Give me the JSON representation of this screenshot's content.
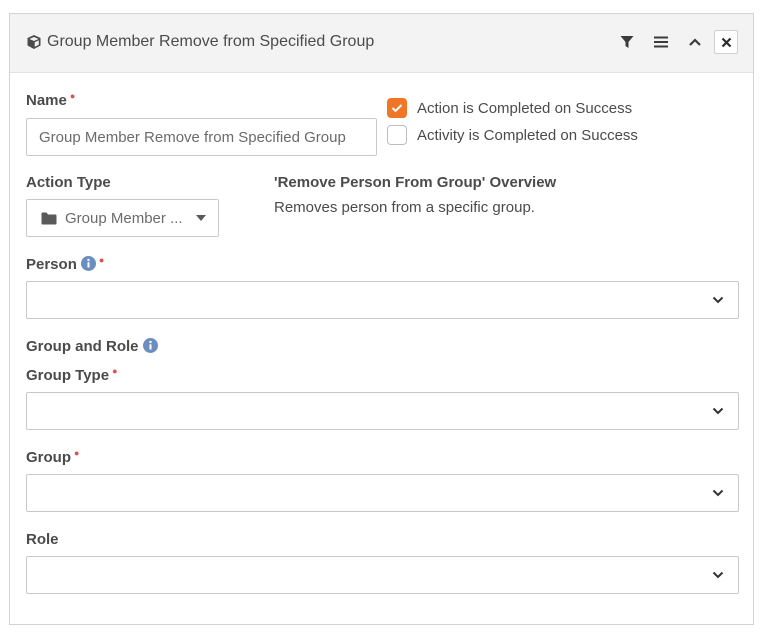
{
  "panel": {
    "title": "Group Member Remove from Specified Group",
    "icons": [
      "cube-icon",
      "filter-icon",
      "hamburger-menu-icon",
      "chevron-up-icon",
      "close-icon"
    ]
  },
  "fields": {
    "name": {
      "label": "Name",
      "value": "Group Member Remove from Specified Group",
      "required": true
    },
    "action_complete": {
      "label": "Action is Completed on Success",
      "checked": true
    },
    "activity_complete": {
      "label": "Activity is Completed on Success",
      "checked": false
    },
    "action_type": {
      "label": "Action Type",
      "value": "Group Member ...",
      "icon": "folder-icon"
    },
    "overview": {
      "title": "'Remove Person From Group' Overview",
      "description": "Removes person from a specific group."
    },
    "person": {
      "label": "Person",
      "value": "",
      "required": true,
      "has_info": true
    },
    "group_and_role": {
      "label": "Group and Role",
      "has_info": true
    },
    "group_type": {
      "label": "Group Type",
      "value": "",
      "required": true
    },
    "group": {
      "label": "Group",
      "value": "",
      "required": true
    },
    "role": {
      "label": "Role",
      "value": ""
    }
  },
  "colors": {
    "accent": "#ee7625",
    "required": "#d9534f",
    "info": "#6c8ebf",
    "header_bg": "#f3f3f3"
  }
}
